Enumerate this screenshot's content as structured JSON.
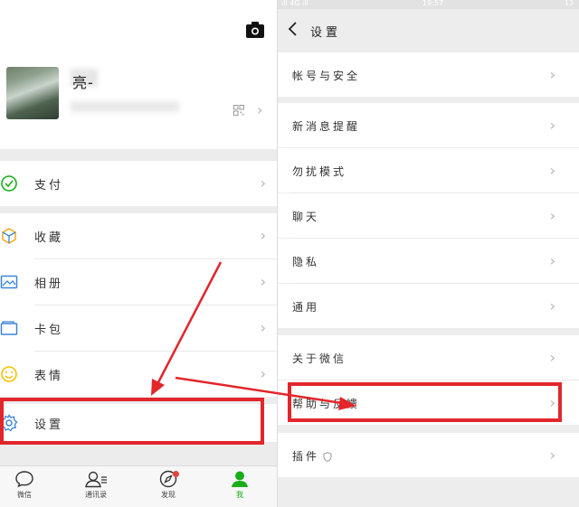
{
  "left": {
    "profile": {
      "nickname": "亮-"
    },
    "menu": [
      {
        "label": "支付",
        "icon": "pay-icon",
        "color": "#1aad19"
      },
      {
        "label": "收藏",
        "icon": "favorites-cube-icon",
        "color": "#f6a623"
      },
      {
        "label": "相册",
        "icon": "album-icon",
        "color": "#3d84d6"
      },
      {
        "label": "卡包",
        "icon": "card-wallet-icon",
        "color": "#3d84d6"
      },
      {
        "label": "表情",
        "icon": "emoji-icon",
        "color": "#f6c000"
      },
      {
        "label": "设置",
        "icon": "settings-gear-icon",
        "color": "#3d84d6"
      }
    ],
    "tabbar": [
      {
        "label": "微信",
        "icon": "chat-bubble-icon"
      },
      {
        "label": "通讯录",
        "icon": "contacts-icon"
      },
      {
        "label": "发现",
        "icon": "compass-icon",
        "badge": true
      },
      {
        "label": "我",
        "icon": "me-person-icon",
        "active": true
      }
    ]
  },
  "right": {
    "statusbar": {
      "left": "ıll 4G ıll",
      "center": "19:57",
      "right": "13"
    },
    "nav": {
      "back_icon": "back-chevron-icon",
      "title": "设置"
    },
    "items": [
      {
        "label": "帐号与安全"
      },
      {
        "label": "新消息提醒"
      },
      {
        "label": "勿扰模式"
      },
      {
        "label": "聊天"
      },
      {
        "label": "隐私"
      },
      {
        "label": "通用"
      },
      {
        "label": "关于微信"
      },
      {
        "label": "帮助与反馈"
      },
      {
        "label": "插件"
      }
    ]
  },
  "annotation": {
    "color": "#e2262b"
  }
}
